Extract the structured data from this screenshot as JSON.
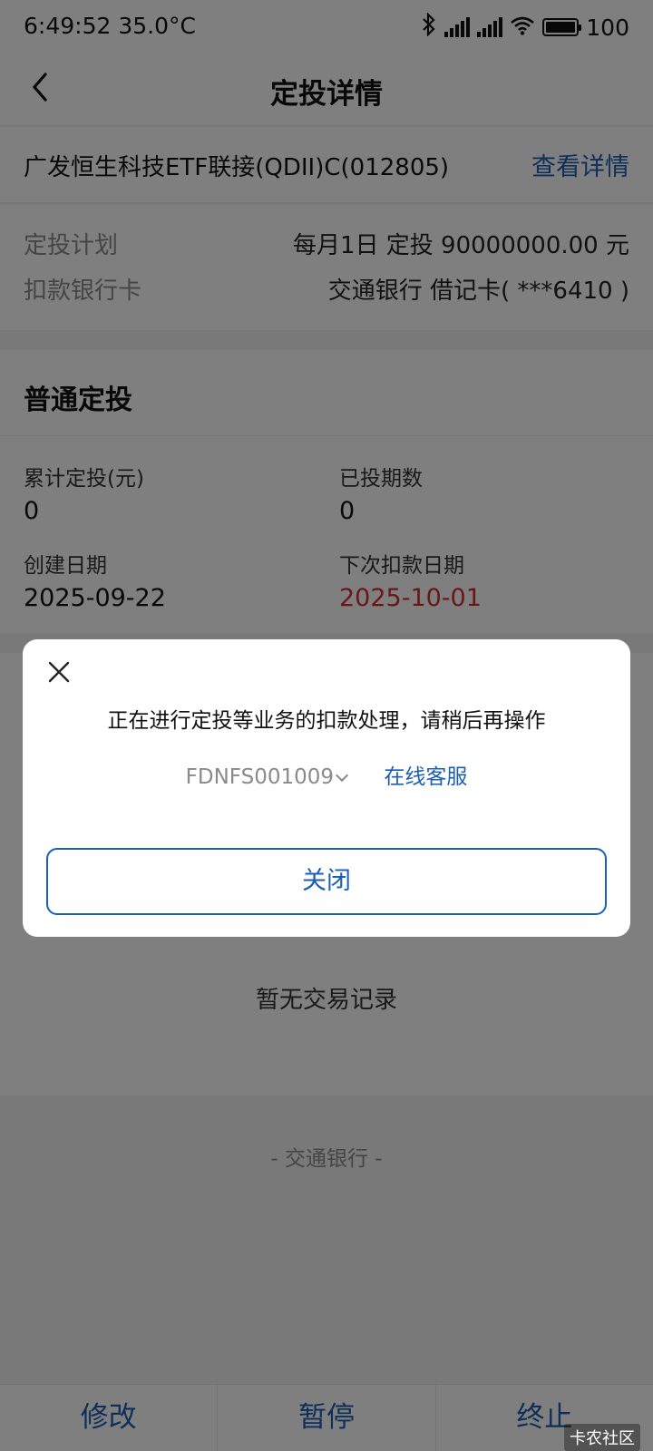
{
  "status_bar": {
    "time_temp": "6:49:52 35.0°C",
    "battery": "100",
    "battery_level": 1.0
  },
  "header": {
    "title": "定投详情"
  },
  "fund": {
    "name": "广发恒生科技ETF联接(QDII)C(012805)",
    "detail_link": "查看详情"
  },
  "plan": {
    "rows": [
      {
        "label": "定投计划",
        "value": "每月1日 定投 90000000.00 元"
      },
      {
        "label": "扣款银行卡",
        "value": "交通银行 借记卡( ***6410 )"
      }
    ]
  },
  "normal_plan": {
    "title": "普通定投",
    "stats": [
      {
        "label": "累计定投(元)",
        "value": "0"
      },
      {
        "label": "已投期数",
        "value": "0"
      },
      {
        "label": "创建日期",
        "value": "2025-09-22"
      },
      {
        "label": "下次扣款日期",
        "value": "2025-10-01"
      }
    ]
  },
  "records": {
    "empty_text": "暂无交易记录"
  },
  "footer": {
    "text": "- 交通银行 -"
  },
  "bottom_bar": {
    "modify": "修改",
    "pause": "暂停",
    "terminate": "终止"
  },
  "watermark": "卡农社区",
  "modal": {
    "message": "正在进行定投等业务的扣款处理，请稍后再操作",
    "code": "FDNFS001009",
    "service_link": "在线客服",
    "close_button": "关闭"
  },
  "colors": {
    "accent": "#1a5fb4",
    "highlight_red": "#d32f2f"
  }
}
